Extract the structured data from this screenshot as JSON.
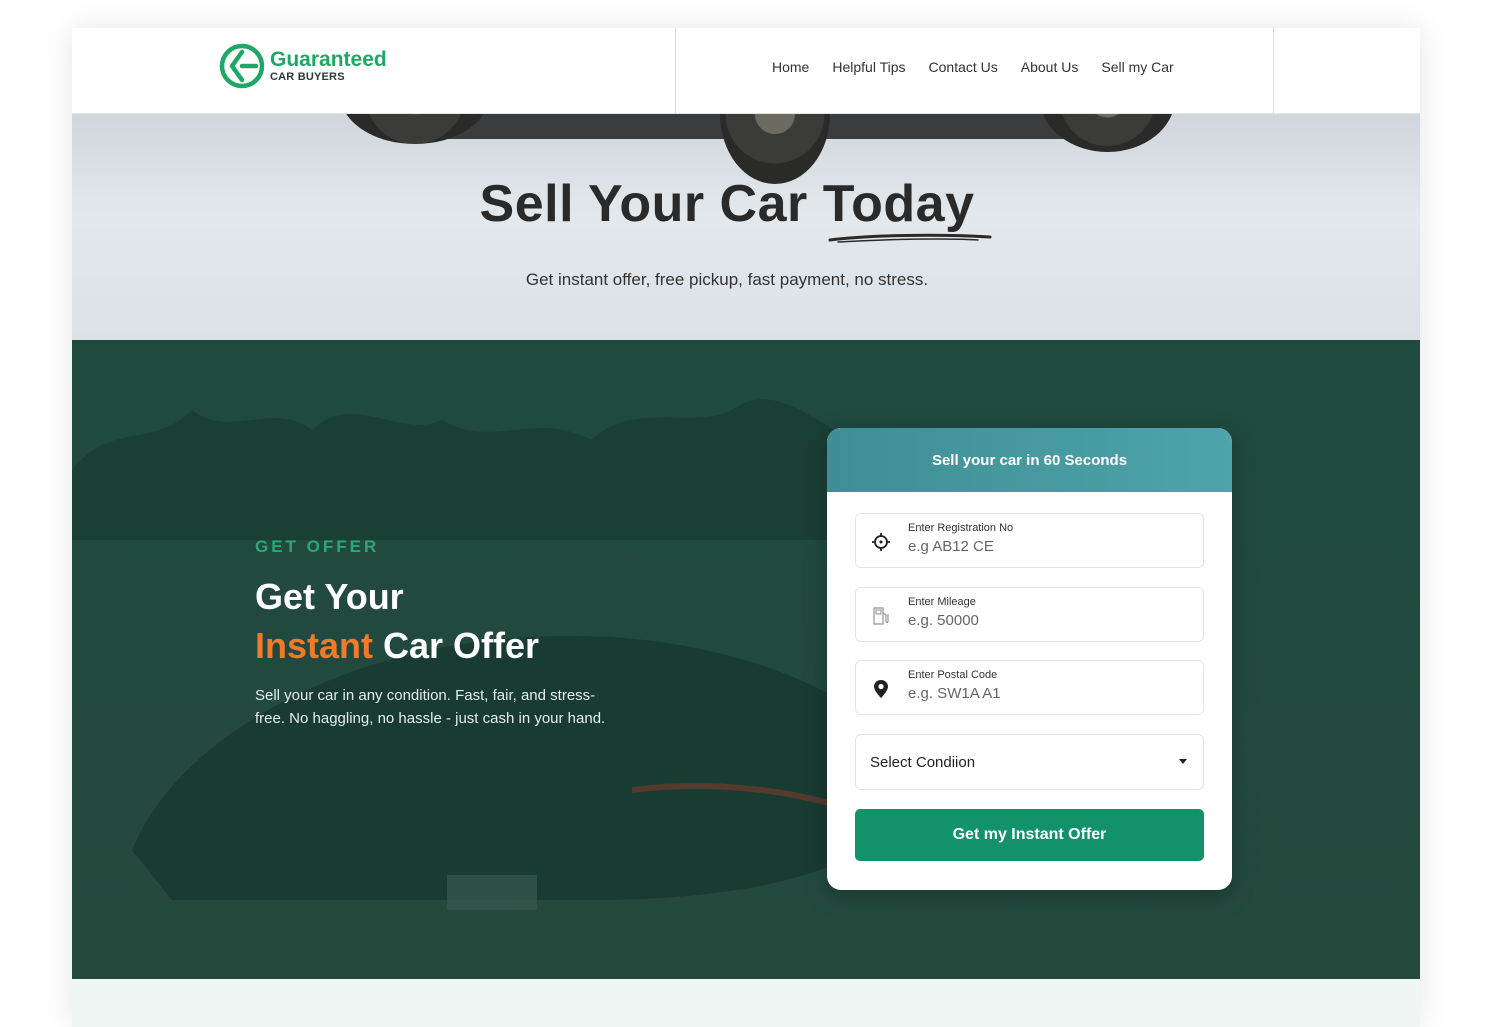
{
  "brand": {
    "name": "Guaranteed",
    "tagline": "CAR BUYERS",
    "color": "#1fa864"
  },
  "nav": [
    {
      "label": "Home"
    },
    {
      "label": "Helpful Tips"
    },
    {
      "label": "Contact Us"
    },
    {
      "label": "About Us"
    },
    {
      "label": "Sell my Car"
    }
  ],
  "hero": {
    "title": "Sell Your Car Today",
    "subtitle": "Get instant offer, free pickup, fast payment,  no stress."
  },
  "offer": {
    "eyebrow": "GET OFFER",
    "headline_line1": "Get Your",
    "headline_accent": "Instant",
    "headline_rest": " Car Offer",
    "description": "Sell your car in any condition. Fast, fair, and stress-free. No haggling, no hassle - just cash in your hand.",
    "accent_color": "#f07a26"
  },
  "form": {
    "title": "Sell your car in 60 Seconds",
    "fields": [
      {
        "label": "Enter  Registration No",
        "placeholder": "e.g AB12 CE",
        "icon": "crosshair-icon"
      },
      {
        "label": "Enter Mileage",
        "placeholder": "e.g. 50000",
        "icon": "fuel-pump-icon"
      },
      {
        "label": "Enter Postal Code",
        "placeholder": "e.g. SW1A A1",
        "icon": "location-pin-icon"
      }
    ],
    "select": {
      "label": "Select Condiion"
    },
    "submit": "Get my Instant Offer",
    "submit_color": "#12926a"
  }
}
